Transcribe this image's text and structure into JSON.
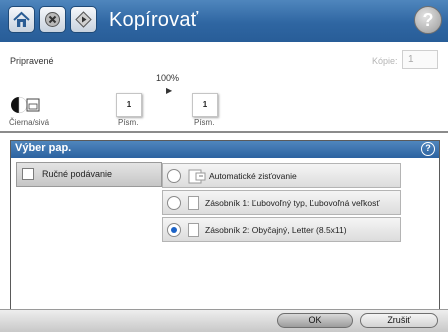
{
  "header": {
    "title": "Kopírovať",
    "home_icon": "home-icon",
    "stop_icon": "stop-icon",
    "start_icon": "start-icon",
    "help_icon": "help-icon",
    "help_symbol": "?"
  },
  "status": {
    "state": "Pripravené",
    "copies_label": "Kópie:",
    "copies_value": "1",
    "zoom": "100%",
    "source_page": "1",
    "dest_page": "1",
    "color_mode_label": "Čierna/sivá",
    "source_label": "Písm.",
    "dest_label": "Písm."
  },
  "dialog": {
    "title": "Výber pap.",
    "help_symbol": "?",
    "manual_feed_label": "Ručné podávanie",
    "options": [
      {
        "label": "Automatické zisťovanie",
        "selected": false
      },
      {
        "label": "Zásobník 1: Ľubovoľný typ, Ľubovoľná veľkosť",
        "selected": false
      },
      {
        "label": "Zásobník 2: Obyčajný, Letter (8.5x11)",
        "selected": true
      }
    ]
  },
  "footer": {
    "ok_label": "OK",
    "cancel_label": "Zrušiť"
  },
  "colors": {
    "header_blue": "#2f66a2",
    "selected_radio": "#1c63c7"
  }
}
